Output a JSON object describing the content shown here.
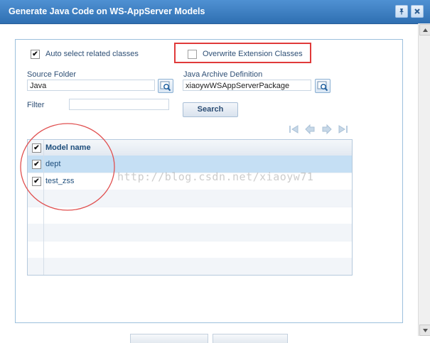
{
  "dialog": {
    "title": "Generate Java Code on WS-AppServer Models"
  },
  "options": {
    "auto_select_label": "Auto select related classes",
    "auto_select_checked": true,
    "overwrite_label": "Overwrite Extension Classes",
    "overwrite_checked": false
  },
  "source_folder": {
    "label": "Source Folder",
    "value": "Java"
  },
  "java_archive": {
    "label": "Java Archive Definition",
    "value": "xiaoywWSAppServerPackage"
  },
  "filter": {
    "label": "Filter",
    "value": "",
    "search_label": "Search"
  },
  "grid": {
    "header": "Model name",
    "header_checked": true,
    "rows": [
      {
        "name": "dept",
        "checked": true,
        "selected": true
      },
      {
        "name": "test_zss",
        "checked": true,
        "selected": false
      }
    ]
  },
  "watermark": "http://blog.csdn.net/xiaoyw71",
  "colors": {
    "title_bar": "#3a7fc5",
    "annotation_red": "#e03a3a",
    "selected_row": "#c5dff4",
    "label_text": "#2e4f75"
  }
}
